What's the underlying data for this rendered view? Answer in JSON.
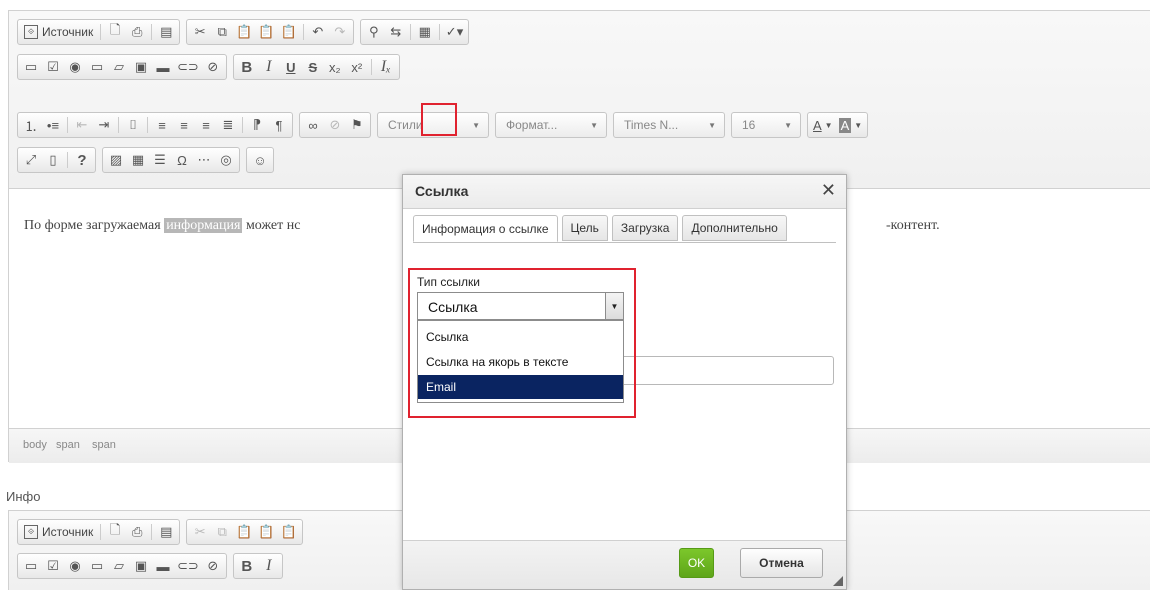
{
  "toolbar": {
    "source_label": "Источник",
    "styles_combo": "Стили",
    "format_combo": "Формат...",
    "font_combo": "Times N...",
    "size_combo": "16",
    "text_color": "A",
    "bg_color": "A",
    "bold": "B",
    "italic": "I",
    "underline": "U",
    "strike": "S"
  },
  "content": {
    "before": "По форме загружаемая ",
    "highlighted": "информация",
    "after": " может нс",
    "tail": "-контент."
  },
  "elements_path": [
    "body",
    "span",
    "span"
  ],
  "second_editor": {
    "label": "Инфо",
    "source_label": "Источник"
  },
  "dialog": {
    "title": "Ссылка",
    "tabs": [
      {
        "label": "Информация о ссылке"
      },
      {
        "label": "Цель"
      },
      {
        "label": "Загрузка"
      },
      {
        "label": "Дополнительно"
      }
    ],
    "link_type_label": "Тип ссылки",
    "link_type_value": "Ссылка",
    "options": [
      {
        "label": "Ссылка"
      },
      {
        "label": "Ссылка на якорь в тексте"
      },
      {
        "label": "Email"
      }
    ],
    "ok_label": "OK",
    "cancel_label": "Отмена"
  },
  "colors": {
    "highlight_frame": "#e0222f",
    "selected_option": "#0a2461",
    "ok_button": "#6db424"
  }
}
